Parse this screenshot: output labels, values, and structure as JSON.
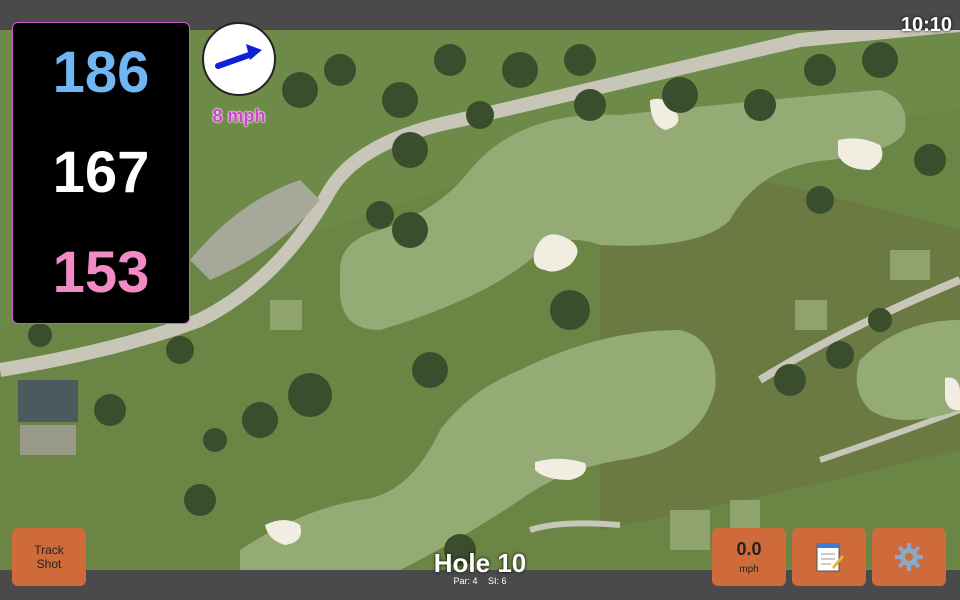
{
  "status": {
    "clock": "10:10"
  },
  "distances": {
    "back": "186",
    "middle": "167",
    "front": "153"
  },
  "wind": {
    "speed_label": "8 mph",
    "direction_icon": "arrow-right-icon"
  },
  "hole": {
    "title": "Hole 10",
    "par": "Par: 4",
    "si": "SI: 6"
  },
  "buttons": {
    "track_line1": "Track",
    "track_line2": "Shot",
    "windspeed_value": "0.0",
    "windspeed_unit": "mph",
    "notes_icon": "notepad-icon",
    "settings_icon": "gear-icon"
  },
  "colors": {
    "back": "#6fb6f2",
    "middle": "#ffffff",
    "front": "#f28ac5",
    "button": "#cf6a3a",
    "wind_text": "#d43fd6"
  }
}
